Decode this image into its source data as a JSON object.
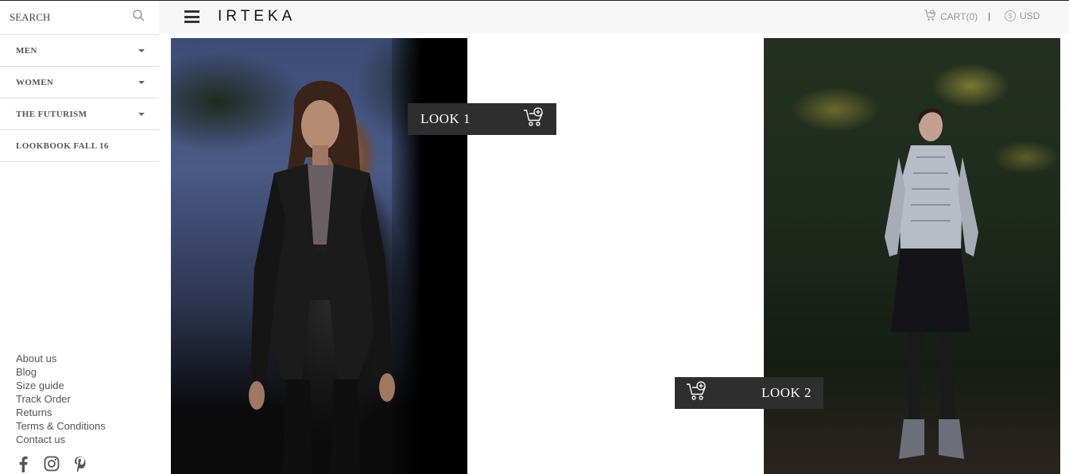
{
  "search": {
    "placeholder": "SEARCH",
    "icon": "magnifier"
  },
  "nav": {
    "items": [
      {
        "label": "MEN",
        "has_dropdown": true
      },
      {
        "label": "WOMEN",
        "has_dropdown": true
      },
      {
        "label": "THE FUTURISM",
        "has_dropdown": true
      },
      {
        "label": "LOOKBOOK FALL 16",
        "has_dropdown": false
      }
    ]
  },
  "footer": {
    "links": [
      "About us",
      "Blog",
      "Size guide",
      "Track Order",
      "Returns",
      "Terms & Conditions",
      "Contact us"
    ],
    "socials": [
      "facebook-icon",
      "instagram-icon",
      "pinterest-icon"
    ]
  },
  "header": {
    "logo": "IRTEKA",
    "cart_label": "CART(0)",
    "separator": "|",
    "currency": "USD"
  },
  "looks": [
    {
      "label": "LOOK 1"
    },
    {
      "label": "LOOK 2"
    }
  ],
  "colors": {
    "badge_bg": "#2e2e2e",
    "topbar_bg": "#f6f6f6",
    "text_muted": "#999999"
  }
}
